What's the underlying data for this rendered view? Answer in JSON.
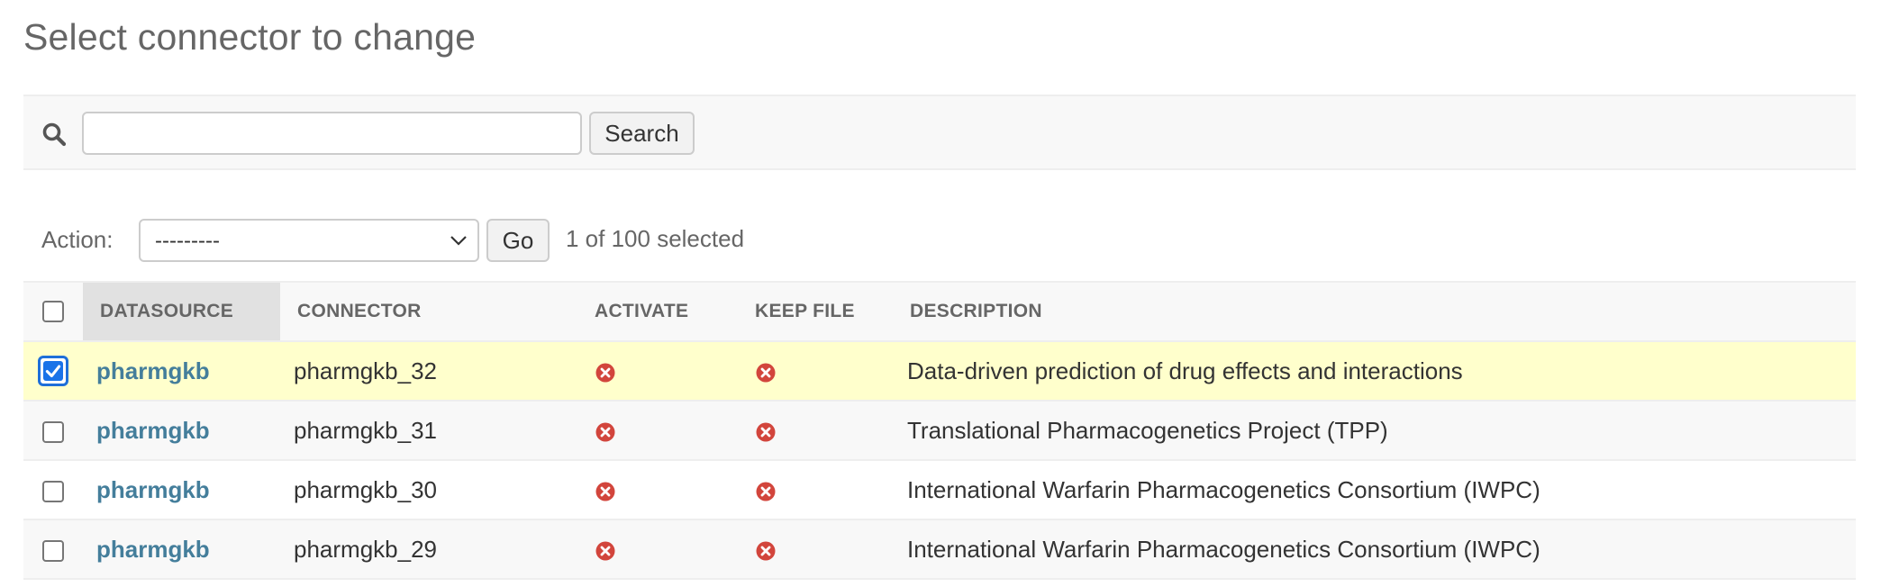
{
  "page": {
    "title": "Select connector to change"
  },
  "search": {
    "placeholder": "",
    "value": "",
    "button_label": "Search",
    "icon": "search-icon"
  },
  "actions": {
    "label": "Action:",
    "selected_option": "---------",
    "go_label": "Go",
    "selection_count": "1 of 100 selected"
  },
  "table": {
    "columns": [
      "Datasource",
      "Connector",
      "Activate",
      "Keep file",
      "Description"
    ],
    "sorted_column": "Datasource",
    "rows": [
      {
        "selected": true,
        "datasource": "pharmgkb",
        "connector": "pharmgkb_32",
        "activate": false,
        "keep_file": false,
        "description": "Data-driven prediction of drug effects and interactions"
      },
      {
        "selected": false,
        "datasource": "pharmgkb",
        "connector": "pharmgkb_31",
        "activate": false,
        "keep_file": false,
        "description": "Translational Pharmacogenetics Project (TPP)"
      },
      {
        "selected": false,
        "datasource": "pharmgkb",
        "connector": "pharmgkb_30",
        "activate": false,
        "keep_file": false,
        "description": "International Warfarin Pharmacogenetics Consortium (IWPC)"
      },
      {
        "selected": false,
        "datasource": "pharmgkb",
        "connector": "pharmgkb_29",
        "activate": false,
        "keep_file": false,
        "description": "International Warfarin Pharmacogenetics Consortium (IWPC)"
      }
    ]
  },
  "colors": {
    "link": "#447e9b",
    "selected_row": "#ffffcc",
    "false_icon": "#d2453c",
    "checkbox_accent": "#1a73e8"
  }
}
